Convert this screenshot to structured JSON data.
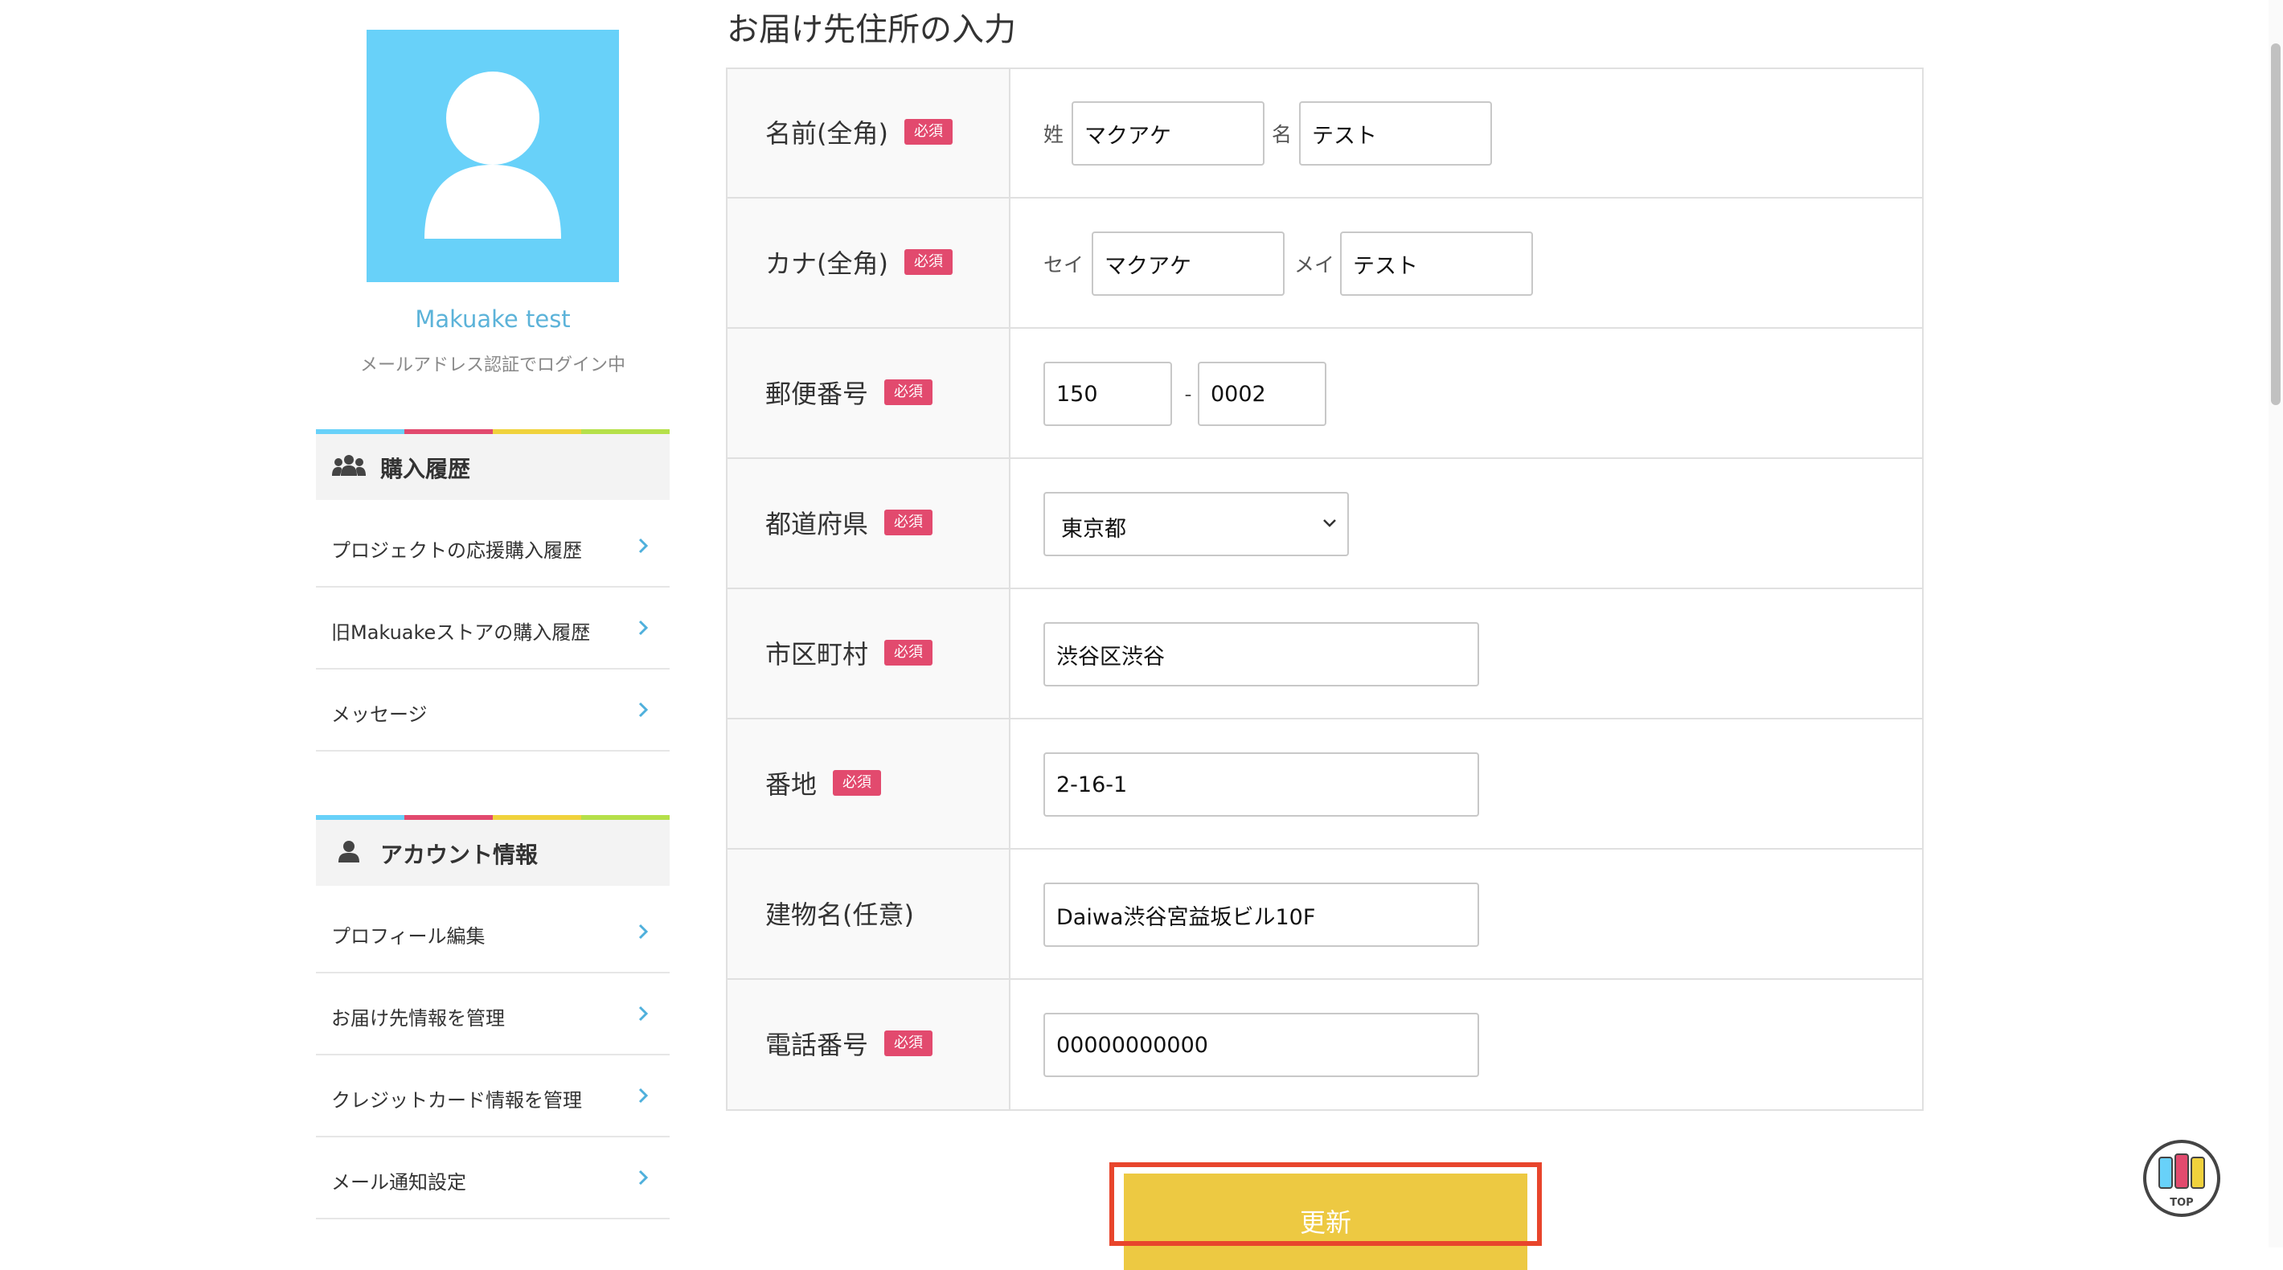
{
  "user": {
    "name": "Makuake test",
    "login_status": "メールアドレス認証でログイン中"
  },
  "stripe_colors": [
    "#68d1f9",
    "#e24a6e",
    "#f0d23c",
    "#b5e04a"
  ],
  "purchase_section": {
    "icon": "people-icon",
    "title": "購入履歴",
    "items": [
      {
        "label": "プロジェクトの応援購入履歴"
      },
      {
        "label": "旧Makuakeストアの購入履歴"
      },
      {
        "label": "メッセージ"
      }
    ]
  },
  "account_section": {
    "icon": "person-icon",
    "title": "アカウント情報",
    "items": [
      {
        "label": "プロフィール編集"
      },
      {
        "label": "お届け先情報を管理"
      },
      {
        "label": "クレジットカード情報を管理"
      },
      {
        "label": "メール通知設定"
      }
    ]
  },
  "form": {
    "title": "お届け先住所の入力",
    "required_badge": "必須",
    "name": {
      "label": "名前(全角)",
      "last_prefix": "姓",
      "last_value": "マクアケ",
      "first_prefix": "名",
      "first_value": "テスト"
    },
    "kana": {
      "label": "カナ(全角)",
      "last_prefix": "セイ",
      "last_value": "マクアケ",
      "first_prefix": "メイ",
      "first_value": "テスト"
    },
    "postal": {
      "label": "郵便番号",
      "part1": "150",
      "separator": "-",
      "part2": "0002"
    },
    "prefecture": {
      "label": "都道府県",
      "value": "東京都"
    },
    "city": {
      "label": "市区町村",
      "value": "渋谷区渋谷"
    },
    "address": {
      "label": "番地",
      "value": "2-16-1"
    },
    "building": {
      "label": "建物名(任意)",
      "value": "Daiwa渋谷宮益坂ビル10F"
    },
    "phone": {
      "label": "電話番号",
      "value": "00000000000"
    },
    "submit_label": "更新"
  },
  "top_button": {
    "label": "TOP",
    "icon": "makuake-top-icon"
  },
  "colors": {
    "accent_blue": "#68d1f9",
    "badge_red": "#e24a6e",
    "button_yellow": "#edc942",
    "highlight_red": "#e8452c"
  }
}
